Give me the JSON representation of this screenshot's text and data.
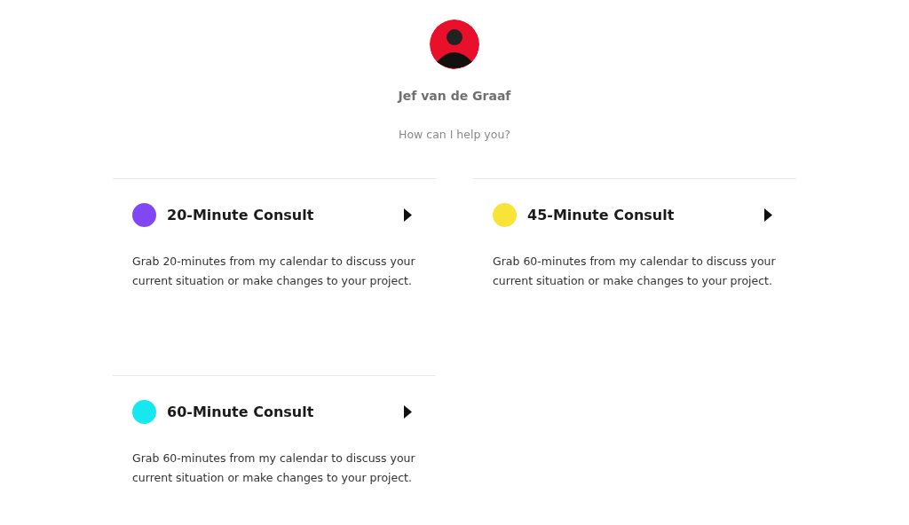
{
  "profile": {
    "name": "Jef van de Graaf",
    "prompt": "How can I help you?"
  },
  "event_types": [
    {
      "title": "20-Minute Consult",
      "color": "#8247f5",
      "description": "Grab 20-minutes from my calendar to discuss your current situation or make changes to your project."
    },
    {
      "title": "45-Minute Consult",
      "color": "#f8e436",
      "description": "Grab 60-minutes from my calendar to discuss your current situation or make changes to your project."
    },
    {
      "title": "60-Minute Consult",
      "color": "#17e8f0",
      "description": "Grab 60-minutes from my calendar to discuss your current situation or make changes to your project."
    }
  ]
}
